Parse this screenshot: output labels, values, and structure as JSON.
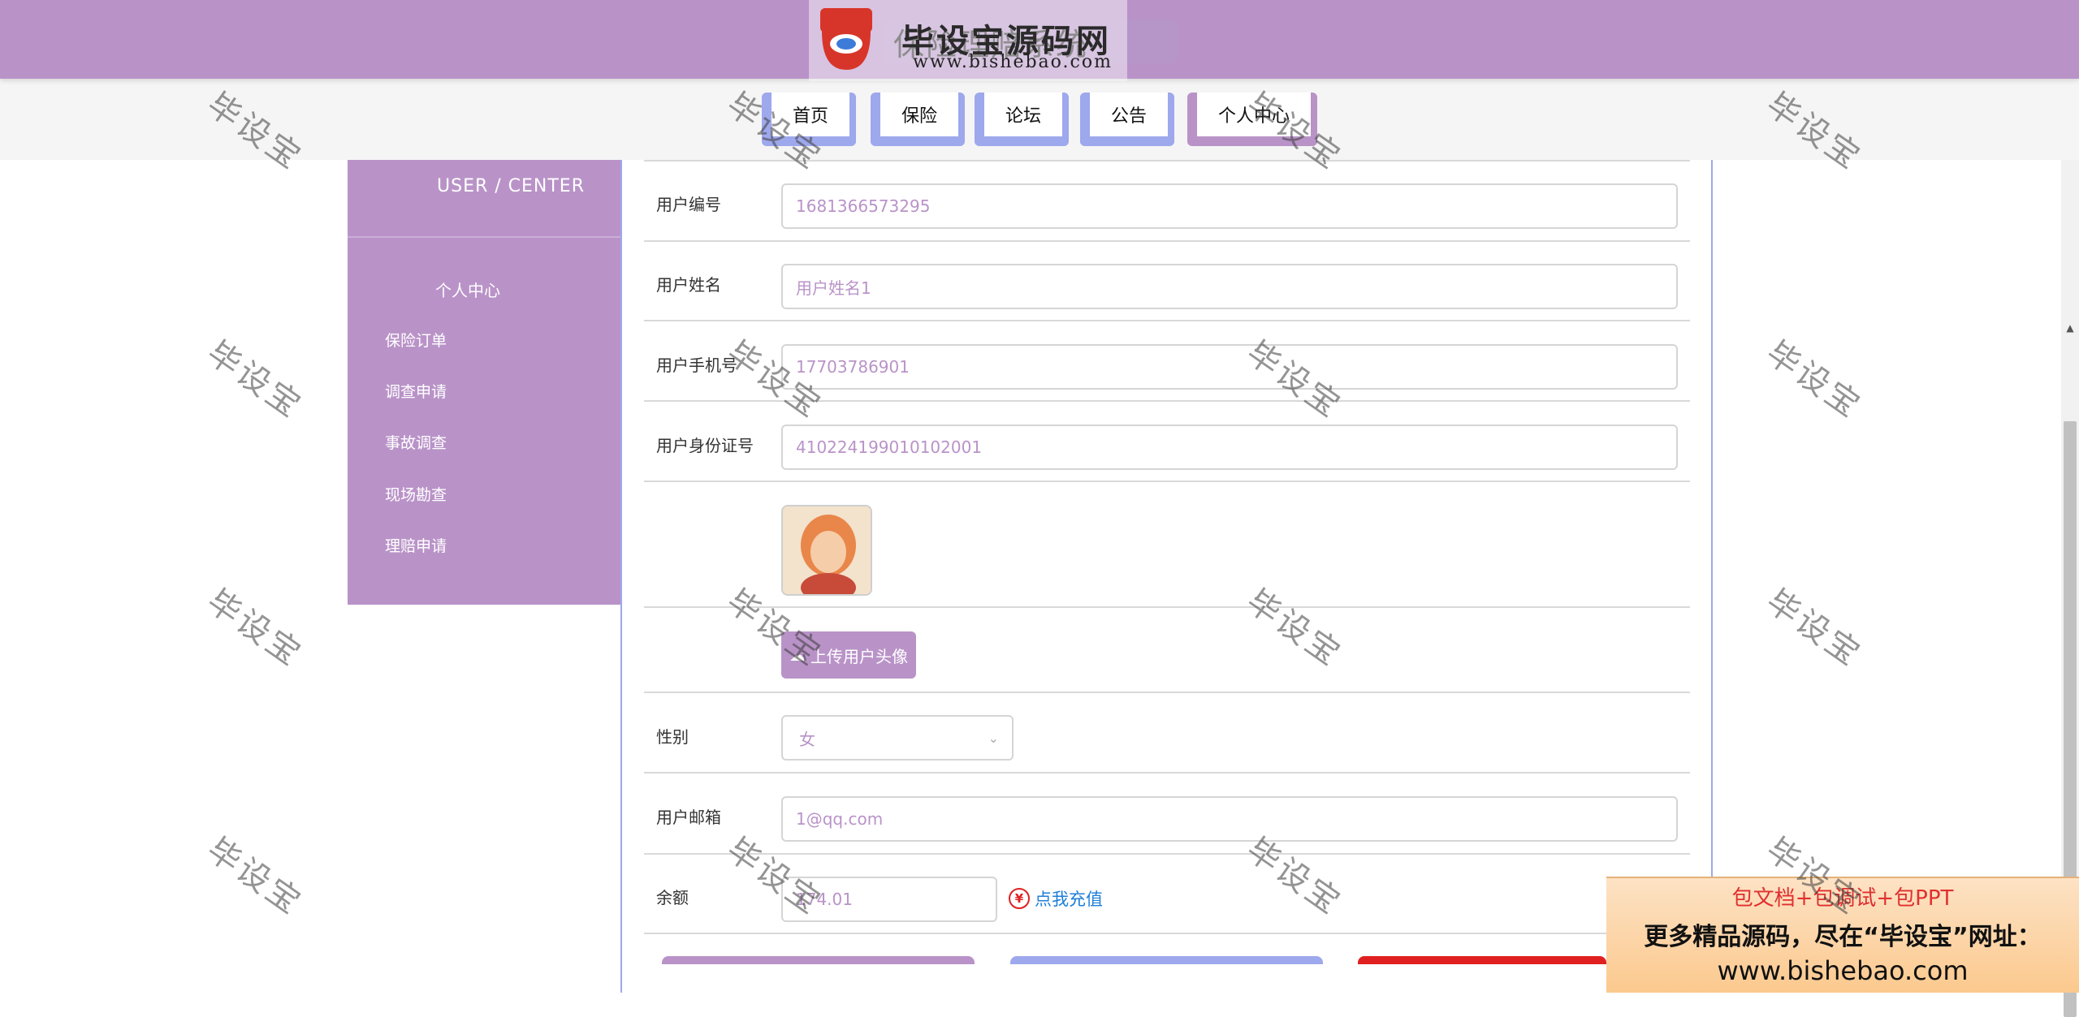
{
  "header": {
    "title": "保险理赔系统"
  },
  "logo": {
    "badge_text": "毕设宝",
    "name": "毕设宝源码网",
    "url": "www.bishebao.com"
  },
  "nav": {
    "items": [
      {
        "label": "首页"
      },
      {
        "label": "保险"
      },
      {
        "label": "论坛"
      },
      {
        "label": "公告"
      },
      {
        "label": "个人中心"
      }
    ]
  },
  "sidebar": {
    "title": "USER / CENTER",
    "heading": "个人中心",
    "items": [
      {
        "label": "保险订单"
      },
      {
        "label": "调查申请"
      },
      {
        "label": "事故调查"
      },
      {
        "label": "现场勘查"
      },
      {
        "label": "理赔申请"
      }
    ]
  },
  "form": {
    "user_no": {
      "label": "用户编号",
      "value": "1681366573295"
    },
    "user_name": {
      "label": "用户姓名",
      "value": "用户姓名1"
    },
    "phone": {
      "label": "用户手机号",
      "value": "17703786901"
    },
    "id_card": {
      "label": "用户身份证号",
      "value": "410224199010102001"
    },
    "upload_button": "上传用户头像",
    "gender": {
      "label": "性别",
      "value": "女"
    },
    "email": {
      "label": "用户邮箱",
      "value": "1@qq.com"
    },
    "balance": {
      "label": "余额",
      "value": "174.01"
    },
    "recharge_link": "点我充值"
  },
  "ad": {
    "line1": "包文档+包调试+包PPT",
    "line2": "更多精品源码，尽在“毕设宝”网址：",
    "line3": "www.bishebao.com"
  },
  "watermark": "毕设宝",
  "colors": {
    "primary": "#b993c8",
    "nav_border": "#9ea8ec",
    "link": "#1e7fd8",
    "danger": "#e02020"
  }
}
